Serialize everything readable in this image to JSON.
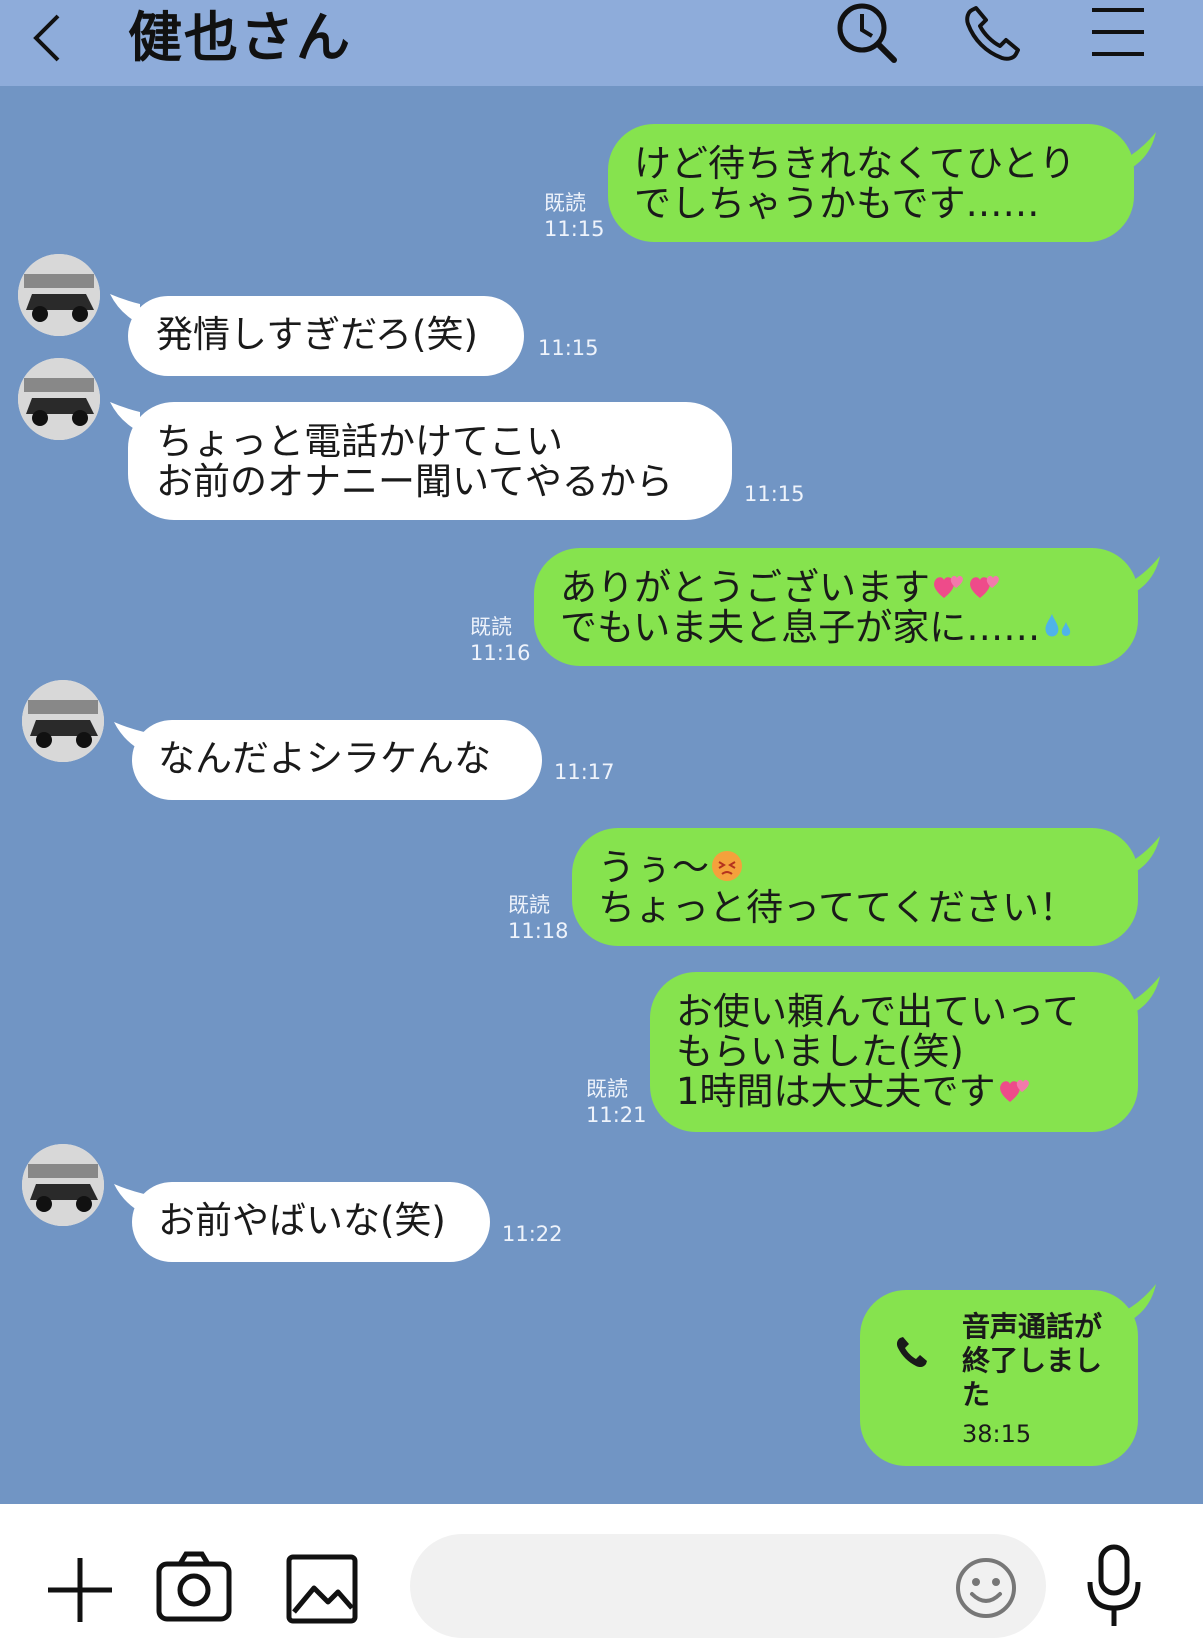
{
  "header": {
    "back_icon": "chevron-left-icon",
    "title": "健也さん",
    "search_icon": "search-clock-icon",
    "call_icon": "phone-icon",
    "menu_icon": "hamburger-menu-icon",
    "background_color": "#8eacda"
  },
  "chat": {
    "background_color": "#7195c4",
    "outgoing_bubble_color": "#86e34e",
    "incoming_bubble_color": "#ffffff",
    "messages": [
      {
        "direction": "out",
        "text": "けど待ちきれなくてひとり\nでしちゃうかもです……",
        "read_label": "既読",
        "time": "11:15"
      },
      {
        "direction": "in",
        "text": "発情しすぎだろ(笑)",
        "time": "11:15"
      },
      {
        "direction": "in",
        "text": "ちょっと電話かけてこい\nお前のオナニー聞いてやるから",
        "time": "11:15"
      },
      {
        "direction": "out",
        "text_line1": "ありがとうございます",
        "text_line2": "でもいま夫と息子が家に……",
        "read_label": "既読",
        "time": "11:16",
        "emoji": [
          "two-hearts-icon",
          "two-hearts-icon",
          "sweat-droplets-icon"
        ]
      },
      {
        "direction": "in",
        "text": "なんだよシラケんな",
        "time": "11:17"
      },
      {
        "direction": "out",
        "text_line1": "うぅ〜",
        "text_line2": "ちょっと待っててください！",
        "read_label": "既読",
        "time": "11:18",
        "emoji": [
          "angry-face-icon"
        ]
      },
      {
        "direction": "out",
        "text_line1": "お使い頼んで出ていって",
        "text_line2": "もらいました(笑)",
        "text_line3": "1時間は大丈夫です",
        "read_label": "既読",
        "time": "11:21",
        "emoji": [
          "two-hearts-icon"
        ]
      },
      {
        "direction": "in",
        "text": "お前やばいな(笑)",
        "time": "11:22"
      },
      {
        "direction": "out",
        "type": "call",
        "text": "音声通話が\n終了しまし\nた",
        "duration": "38:15",
        "icon": "phone-icon"
      }
    ]
  },
  "footer": {
    "add_icon": "plus-icon",
    "camera_icon": "camera-icon",
    "image_icon": "image-icon",
    "input_value": "",
    "emoji_icon": "smiley-icon",
    "mic_icon": "microphone-icon"
  }
}
